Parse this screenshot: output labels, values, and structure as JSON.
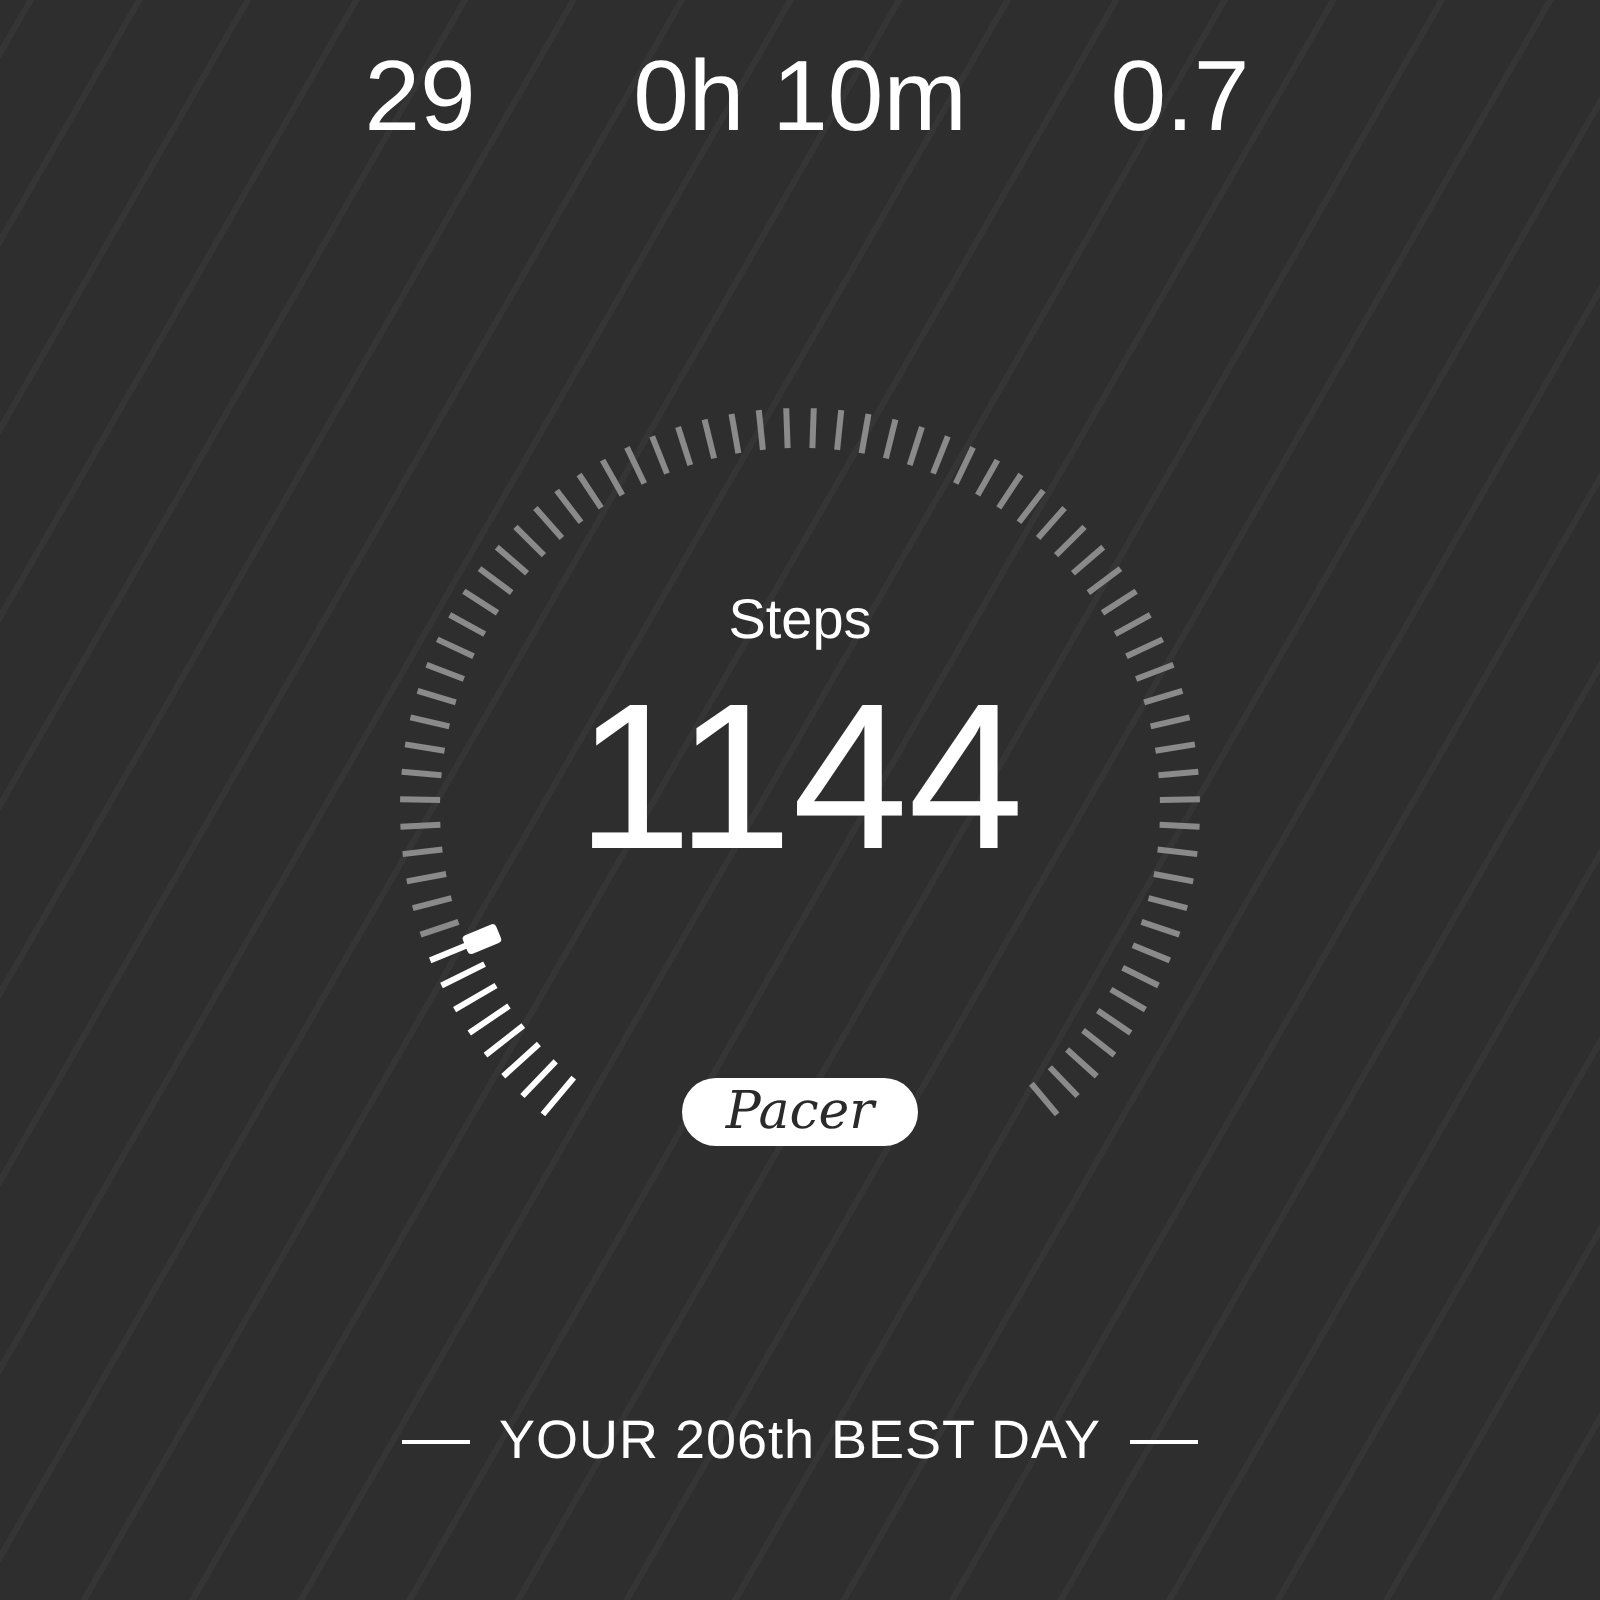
{
  "stats": [
    {
      "value": "29"
    },
    {
      "value": "0h 10m"
    },
    {
      "value": "0.7"
    }
  ],
  "gauge": {
    "label": "Steps",
    "value": "1144"
  },
  "logo": {
    "text": "Pacer"
  },
  "rank": {
    "text": "YOUR 206th BEST DAY"
  }
}
